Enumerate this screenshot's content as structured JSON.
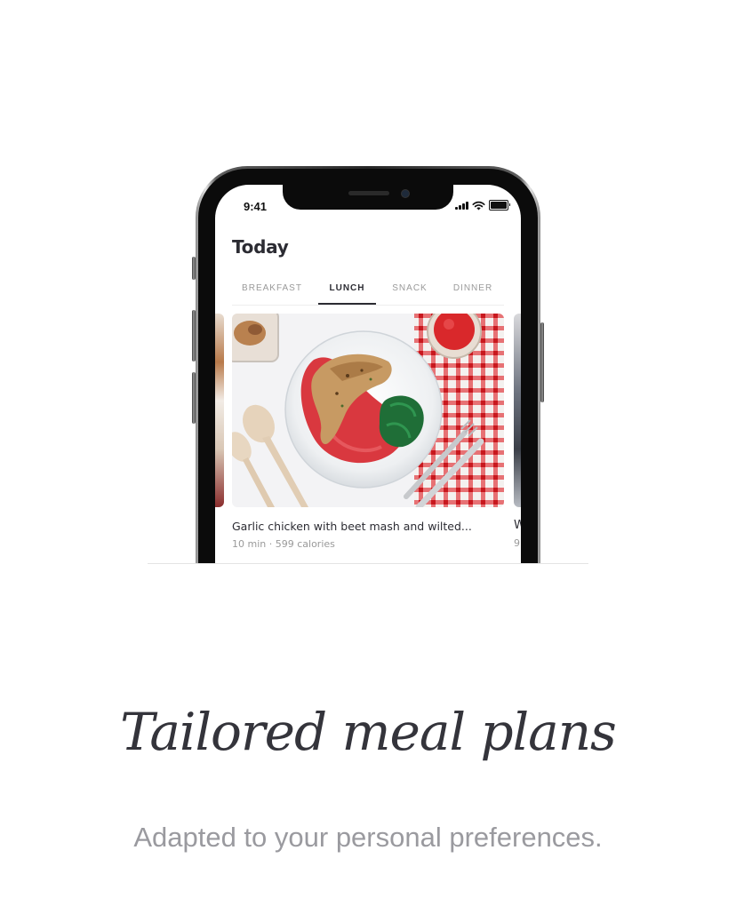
{
  "status_bar": {
    "time": "9:41",
    "icons": [
      "cellular-signal-icon",
      "wifi-icon",
      "battery-icon"
    ]
  },
  "screen": {
    "title": "Today",
    "tabs": [
      {
        "label": "BREAKFAST",
        "active": false
      },
      {
        "label": "LUNCH",
        "active": true
      },
      {
        "label": "SNACK",
        "active": false
      },
      {
        "label": "DINNER",
        "active": false
      }
    ],
    "cards": [
      {
        "title": "Garlic chicken with beet mash and wilted...",
        "meta": "10 min · 599 calories",
        "image": "garlic-chicken-beet-mash-photo"
      },
      {
        "title": "W",
        "meta": "9",
        "image": "partial-next-meal-photo"
      }
    ]
  },
  "headline": "Tailored meal plans",
  "subtitle": "Adapted to your personal preferences.",
  "colors": {
    "text_dark": "#2c2c33",
    "text_muted": "#9a9a9a",
    "subtitle": "#9a9a9f",
    "beet_red": "#d9383f",
    "checker_red": "#d8262c"
  }
}
